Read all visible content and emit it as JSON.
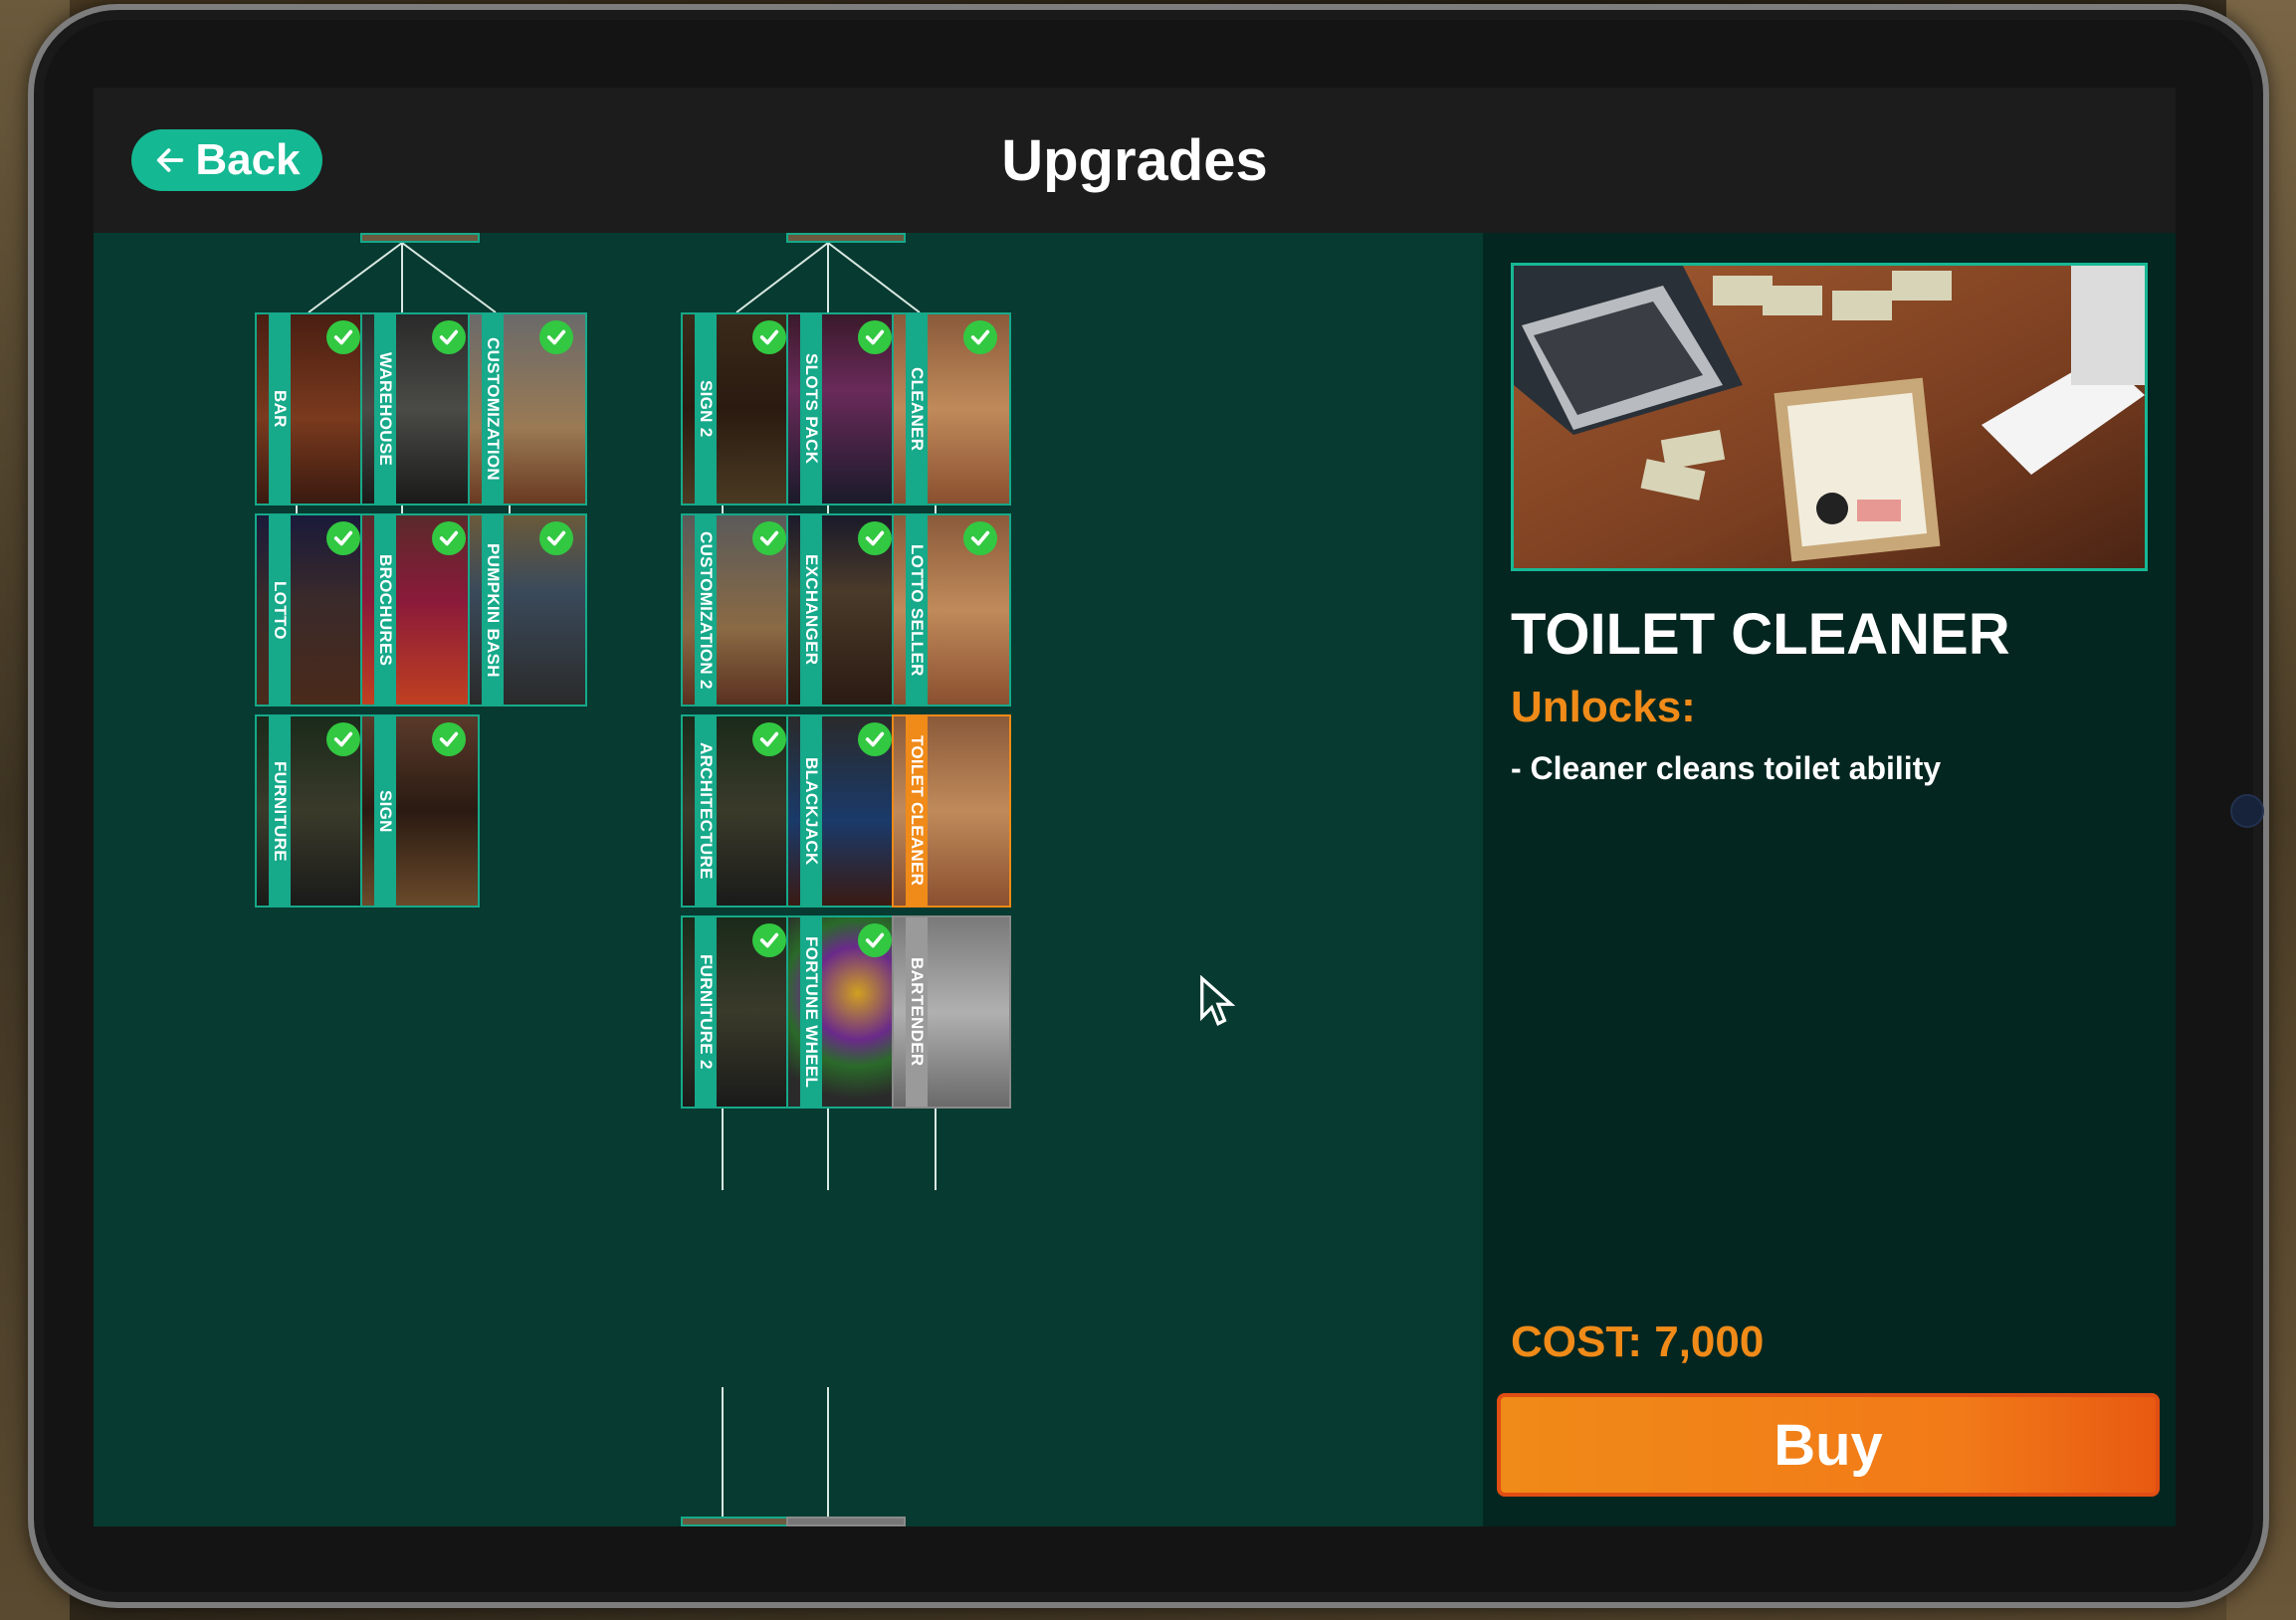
{
  "header": {
    "back_label": "Back",
    "title": "Upgrades"
  },
  "tree": {
    "nodes": [
      {
        "label": "BAR",
        "owned": true,
        "state": "owned"
      },
      {
        "label": "WAREHOUSE",
        "owned": true,
        "state": "owned"
      },
      {
        "label": "CUSTOMIZATION",
        "owned": true,
        "state": "owned"
      },
      {
        "label": "LOTTO",
        "owned": true,
        "state": "owned"
      },
      {
        "label": "BROCHURES",
        "owned": true,
        "state": "owned"
      },
      {
        "label": "PUMPKIN BASH",
        "owned": true,
        "state": "owned"
      },
      {
        "label": "FURNITURE",
        "owned": true,
        "state": "owned"
      },
      {
        "label": "SIGN",
        "owned": true,
        "state": "owned"
      },
      {
        "label": "SIGN 2",
        "owned": true,
        "state": "owned"
      },
      {
        "label": "SLOTS PACK",
        "owned": true,
        "state": "owned"
      },
      {
        "label": "CLEANER",
        "owned": true,
        "state": "owned"
      },
      {
        "label": "CUSTOMIZATION 2",
        "owned": true,
        "state": "owned"
      },
      {
        "label": "EXCHANGER",
        "owned": true,
        "state": "owned"
      },
      {
        "label": "LOTTO SELLER",
        "owned": true,
        "state": "owned"
      },
      {
        "label": "ARCHITECTURE",
        "owned": true,
        "state": "owned"
      },
      {
        "label": "BLACKJACK",
        "owned": true,
        "state": "owned"
      },
      {
        "label": "TOILET CLEANER",
        "owned": false,
        "state": "selected"
      },
      {
        "label": "FURNITURE 2",
        "owned": true,
        "state": "owned"
      },
      {
        "label": "FORTUNE WHEEL",
        "owned": true,
        "state": "owned"
      },
      {
        "label": "BARTENDER",
        "owned": false,
        "state": "locked"
      }
    ]
  },
  "detail": {
    "name": "TOILET CLEANER",
    "unlocks_label": "Unlocks:",
    "unlock_items": [
      "- Cleaner cleans toilet ability"
    ],
    "cost_label": "COST: 7,000",
    "buy_label": "Buy"
  },
  "colors": {
    "accent_teal": "#16a98a",
    "accent_orange": "#f08a18",
    "check_green": "#32c842",
    "tree_bg": "#073a30",
    "panel_bg": "#032620",
    "header_bg": "#1c1c1c"
  },
  "icons": {
    "back": "arrow-left-icon",
    "owned": "checkmark-icon",
    "cursor": "mouse-pointer-icon"
  }
}
